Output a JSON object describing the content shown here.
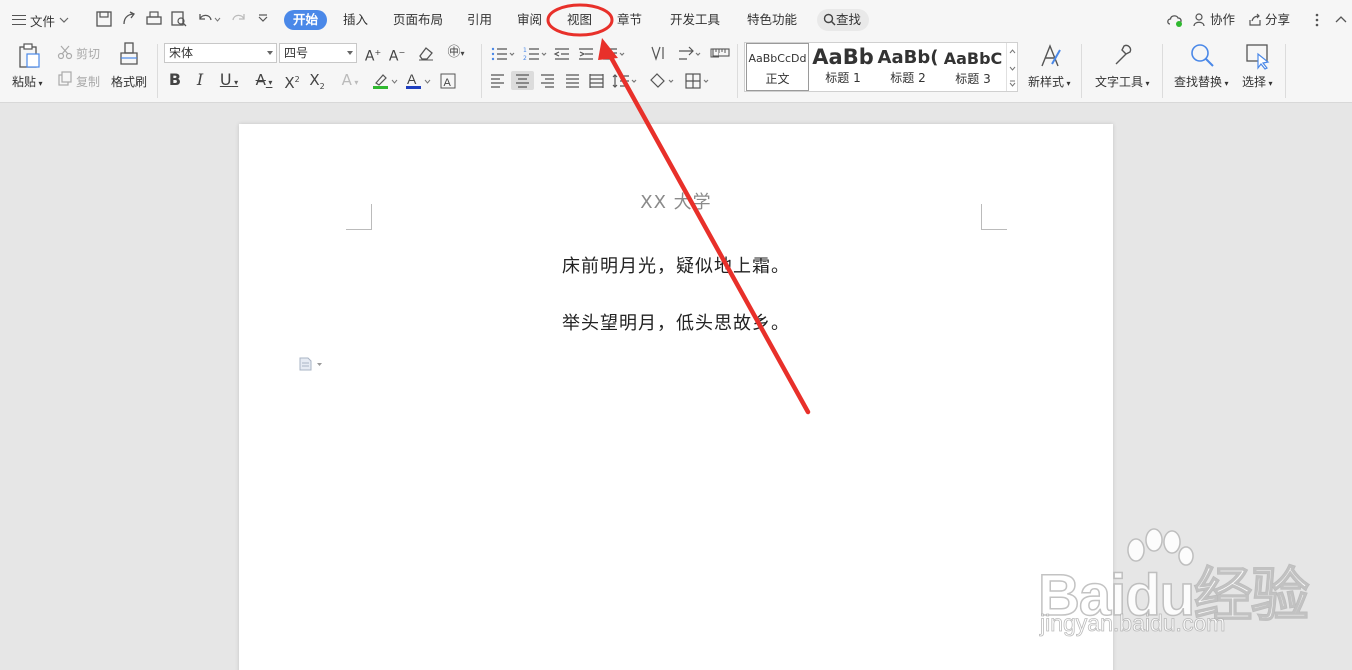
{
  "tabbar": {
    "menu_label": "文件",
    "tabs": [
      {
        "label": "开始",
        "active": true
      },
      {
        "label": "插入"
      },
      {
        "label": "页面布局"
      },
      {
        "label": "引用"
      },
      {
        "label": "审阅"
      },
      {
        "label": "视图"
      },
      {
        "label": "章节"
      },
      {
        "label": "开发工具"
      },
      {
        "label": "特色功能"
      }
    ],
    "search_label": "查找",
    "collab_label": "协作",
    "share_label": "分享"
  },
  "ribbon": {
    "paste_label": "粘贴",
    "cut_label": "剪切",
    "copy_label": "复制",
    "format_painter_label": "格式刷",
    "font_name": "宋体",
    "font_size": "四号",
    "styles": [
      {
        "preview": "AaBbCcDd",
        "name": "正文"
      },
      {
        "preview": "AaBb",
        "name": "标题 1"
      },
      {
        "preview": "AaBb(",
        "name": "标题 2"
      },
      {
        "preview": "AaBbC",
        "name": "标题 3"
      }
    ],
    "new_style_label": "新样式",
    "text_tools_label": "文字工具",
    "find_replace_label": "查找替换",
    "select_label": "选择"
  },
  "document": {
    "header": "XX 大学",
    "lines": [
      "床前明月光，疑似地上霜。",
      "举头望明月，低头思故乡。"
    ]
  },
  "watermark": {
    "logo": "Baidu经验",
    "url": "jingyan.baidu.com"
  },
  "colors": {
    "accent": "#4a88e8",
    "annotation": "#e8302a",
    "highlight_green": "#2fb82f",
    "font_color_blue": "#1f3fbf"
  }
}
